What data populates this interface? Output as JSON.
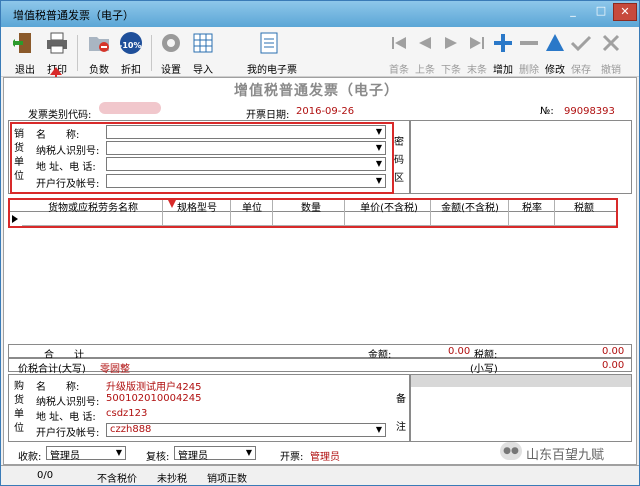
{
  "window": {
    "title": "增值税普通发票（电子）"
  },
  "toolbar": {
    "exit": "退出",
    "print": "打印",
    "negative": "负数",
    "discount": "折扣",
    "settings": "设置",
    "import": "导入",
    "my_einvoice": "我的电子票",
    "first": "首条",
    "prev": "上条",
    "next": "下条",
    "last": "末条",
    "add": "增加",
    "delete": "删除",
    "edit": "修改",
    "save": "保存",
    "cancel": "撤销",
    "discount_badge": "-10%"
  },
  "invoice": {
    "heading": "增值税普通发票（电子）",
    "code_label": "发票类别代码:",
    "date_label": "开票日期:",
    "date_value": "2016-09-26",
    "no_label": "№:",
    "no_value": "99098393"
  },
  "seller": {
    "side_label": [
      "销",
      "货",
      "单",
      "位"
    ],
    "name_label": "名　　称:",
    "tax_id_label": "纳税人识别号:",
    "address_label": "地 址、电 话:",
    "bank_label": "开户行及帐号:"
  },
  "cipher": {
    "label": [
      "密",
      "码",
      "区"
    ]
  },
  "table": {
    "headers": [
      "货物或应税劳务名称",
      "规格型号",
      "单位",
      "数量",
      "单价(不含税)",
      "金额(不含税)",
      "税率",
      "税额"
    ]
  },
  "totals": {
    "total_label": "合　　计",
    "amount_label": "金额:",
    "amount_value": "0.00",
    "tax_label": "税额:",
    "tax_value": "0.00",
    "sum_upper_label": "价税合计(大写)",
    "sum_upper_value": "零圆整",
    "sum_lower_label": "(小写)",
    "sum_lower_value": "0.00"
  },
  "buyer": {
    "side_label": [
      "购",
      "货",
      "单",
      "位"
    ],
    "name_label": "名　　称:",
    "name_value": "升级版测试用户4245",
    "tax_id_label": "纳税人识别号:",
    "tax_id_value": "500102010004245",
    "address_label": "地 址、电 话:",
    "address_value": "csdz123",
    "bank_label": "开户行及帐号:",
    "bank_value": "czzh888"
  },
  "remark": {
    "label": [
      "备",
      "注"
    ]
  },
  "people": {
    "payee_label": "收款:",
    "payee_value": "管理员",
    "checker_label": "复核:",
    "checker_value": "管理员",
    "issuer_label": "开票:",
    "issuer_value": "管理员"
  },
  "status": {
    "a": "0/0",
    "b": "不含税价",
    "c": "未抄税",
    "d": "销项正数"
  },
  "watermark": "山东百望九赋",
  "colors": {
    "accent_red": "#d82a2a",
    "value_red": "#b01010",
    "title_blue": "#5ba6d6"
  }
}
